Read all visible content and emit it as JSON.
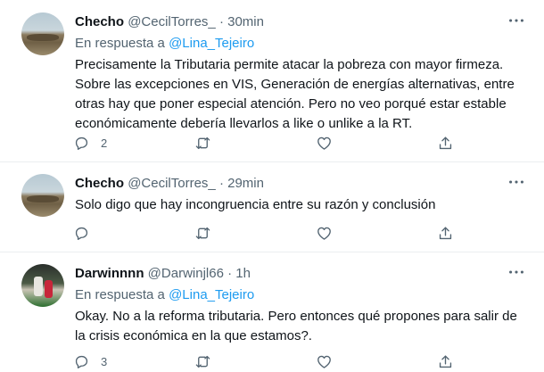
{
  "tweets": [
    {
      "name": "Checho",
      "handle": "@CecilTorres_",
      "separator": "·",
      "time": "30min",
      "reply_prefix": "En respuesta a",
      "reply_mention": "@Lina_Tejeiro",
      "lines": [
        "Precisamente la Tributaria permite atacar la pobreza con mayor firmeza.",
        "Sobre las excepciones en VIS, Generación de energías alternativas, entre",
        "otras hay que poner especial atención. Pero no veo porqué estar estable",
        "económicamente debería llevarlos a like o unlike a la RT."
      ],
      "reply_count": "2",
      "retweet_count": "",
      "like_count": ""
    },
    {
      "name": "Checho",
      "handle": "@CecilTorres_",
      "separator": "·",
      "time": "29min",
      "lines": [
        "Solo digo que hay incongruencia entre su razón y conclusión"
      ],
      "reply_count": "",
      "retweet_count": "",
      "like_count": ""
    },
    {
      "name": "Darwinnnn",
      "handle": "@Darwinjl66",
      "separator": "·",
      "time": "1h",
      "reply_prefix": "En respuesta a",
      "reply_mention": "@Lina_Tejeiro",
      "lines": [
        "Okay. No a la reforma tributaria. Pero entonces qué propones para salir de",
        "la crisis económica en la que estamos?."
      ],
      "reply_count": "3",
      "retweet_count": "",
      "like_count": ""
    }
  ],
  "icons": {
    "reply": "comment-icon",
    "retweet": "retweet-icon",
    "like": "heart-icon",
    "share": "share-icon",
    "more": "more-options-icon"
  },
  "colors": {
    "text": "#0f1419",
    "secondary": "#536471",
    "link": "#1d9bf0",
    "border": "#ebeef0"
  }
}
